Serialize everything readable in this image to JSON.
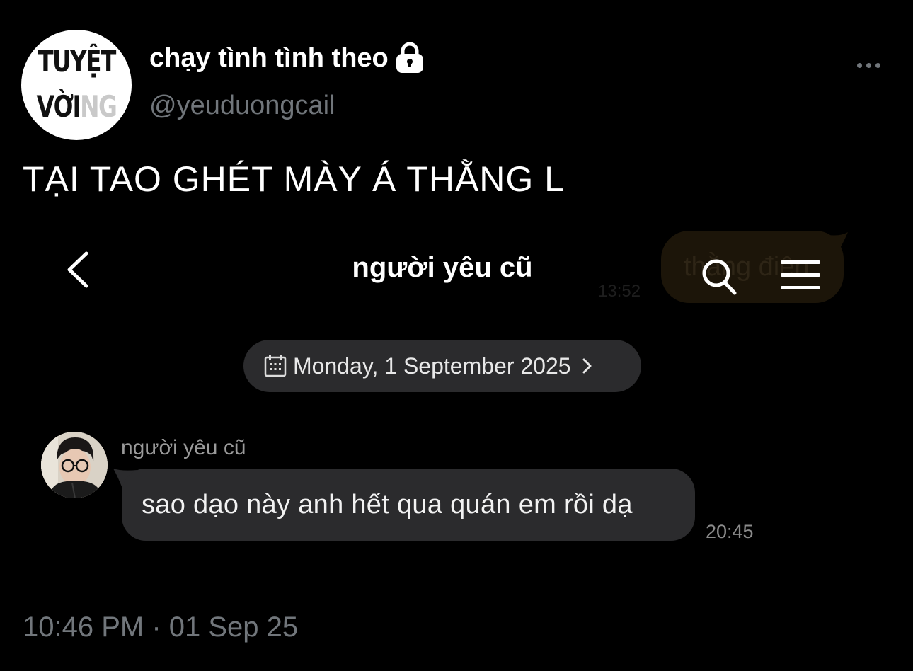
{
  "post": {
    "avatar_text_line1": "TUYỆT",
    "avatar_text_line2_main": "VỜI",
    "avatar_text_line2_faded": "NG",
    "display_name": "chạy tình tình theo",
    "handle": "@yeuduongcail",
    "text": "TẠI TAO GHÉT MÀY Á THẰNG L",
    "timestamp": "10:46 PM · 01 Sep 25",
    "more_icon": "more-horizontal-icon",
    "lock_icon": "lock-icon"
  },
  "chat": {
    "title": "người yêu cũ",
    "back_icon": "chevron-left-icon",
    "search_icon": "search-icon",
    "menu_icon": "hamburger-menu-icon",
    "ghost_message": {
      "text": "thằng điên",
      "time": "13:52"
    },
    "date_pill": "Monday, 1 September 2025",
    "messages": [
      {
        "sender": "người yêu cũ",
        "text": "sao dạo này anh hết qua quán em rồi dạ",
        "time": "20:45"
      }
    ]
  },
  "colors": {
    "background": "#000000",
    "muted_text": "#71767b",
    "bubble": "#2b2b2d",
    "ghost_bubble": "#1c1509"
  }
}
